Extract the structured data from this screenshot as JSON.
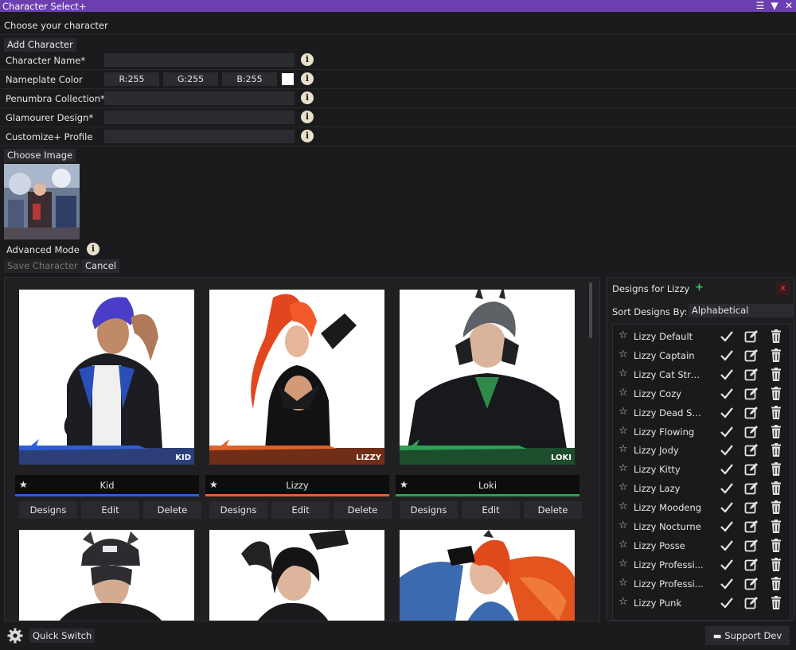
{
  "window": {
    "title": "Character Select+",
    "controls": [
      "menu-icon",
      "collapse-icon",
      "close-icon"
    ]
  },
  "form": {
    "heading": "Choose your character",
    "add_character": "Add Character",
    "character_name_label": "Character Name*",
    "nameplate_color_label": "Nameplate Color",
    "rgb": {
      "r": "R:255",
      "g": "G:255",
      "b": "B:255"
    },
    "nameplate_color": "#ffffff",
    "penumbra_label": "Penumbra Collection*",
    "glamourer_label": "Glamourer Design*",
    "customize_label": "Customize+ Profile",
    "choose_image": "Choose Image",
    "advanced_mode": "Advanced Mode",
    "save_character": "Save Character",
    "cancel": "Cancel",
    "info_glyph": "i"
  },
  "characters": [
    {
      "name": "Kid",
      "tag": "KID",
      "color": "#2c5fd6",
      "star": "★",
      "designs": "Designs",
      "edit": "Edit",
      "delete": "Delete"
    },
    {
      "name": "Lizzy",
      "tag": "LIZZY",
      "color": "#e0622a",
      "star": "★",
      "designs": "Designs",
      "edit": "Edit",
      "delete": "Delete"
    },
    {
      "name": "Loki",
      "tag": "LOKI",
      "color": "#2e9e55",
      "star": "★",
      "designs": "Designs",
      "edit": "Edit",
      "delete": "Delete"
    }
  ],
  "designs_panel": {
    "title": "Designs for Lizzy",
    "add": "+",
    "close": "x",
    "sort_label": "Sort Designs By:",
    "sort_value": "Alphabetical",
    "items": [
      "Lizzy Default",
      "Lizzy Captain",
      "Lizzy Cat Stre...",
      "Lizzy Cozy",
      "Lizzy Dead So...",
      "Lizzy Flowing",
      "Lizzy Jody",
      "Lizzy Kitty",
      "Lizzy Lazy",
      "Lizzy Moodeng",
      "Lizzy Nocturne",
      "Lizzy Posse",
      "Lizzy Professi...",
      "Lizzy Professi...",
      "Lizzy Punk"
    ]
  },
  "footer": {
    "quick_switch": "Quick Switch",
    "support_dev": "Support Dev"
  }
}
